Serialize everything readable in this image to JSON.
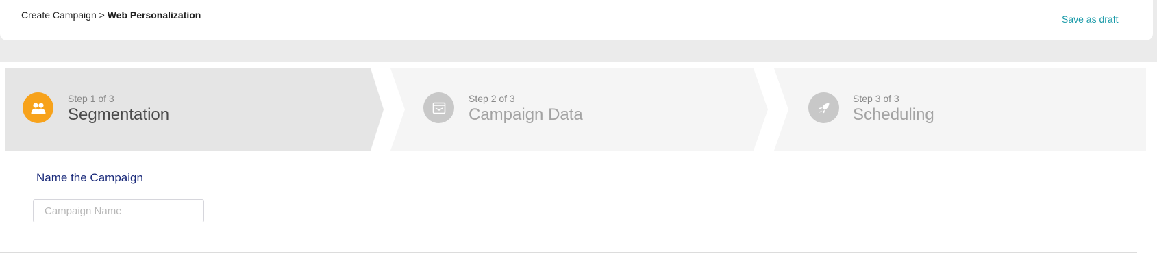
{
  "header": {
    "breadcrumb_parent": "Create Campaign",
    "breadcrumb_separator": ">",
    "breadcrumb_current": "Web Personalization",
    "save_draft_label": "Save as draft"
  },
  "steps": [
    {
      "number_label": "Step 1 of 3",
      "title": "Segmentation",
      "icon": "users-icon",
      "state": "active"
    },
    {
      "number_label": "Step 2 of 3",
      "title": "Campaign Data",
      "icon": "inbox-icon",
      "state": "inactive"
    },
    {
      "number_label": "Step 3 of 3",
      "title": "Scheduling",
      "icon": "rocket-icon",
      "state": "inactive"
    }
  ],
  "form": {
    "name_label": "Name the Campaign",
    "name_placeholder": "Campaign Name",
    "name_value": ""
  },
  "colors": {
    "accent_link": "#1a9aa8",
    "active_step_circle": "#f7a21b",
    "inactive_step_circle": "#c8c8c8",
    "active_step_bg": "#e5e5e5",
    "inactive_step_bg": "#f5f5f5",
    "label_navy": "#1a2a7a"
  }
}
